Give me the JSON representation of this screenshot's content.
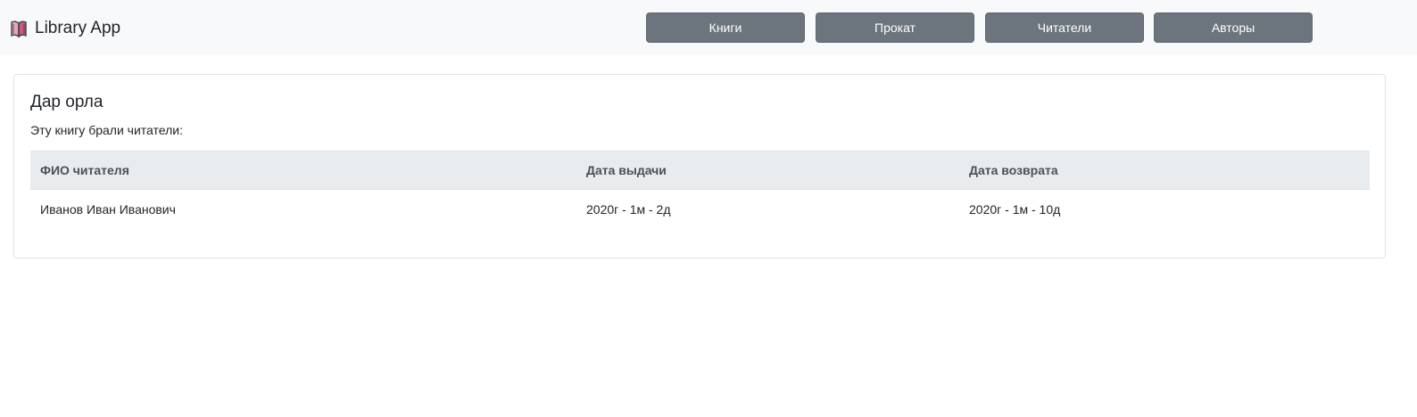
{
  "app": {
    "brand": "Library App",
    "brand_icon": "open-book-icon"
  },
  "nav": {
    "books": "Книги",
    "rentals": "Прокат",
    "readers": "Читатели",
    "authors": "Авторы"
  },
  "book": {
    "title": "Дар орла",
    "subtitle": "Эту книгу брали читатели:"
  },
  "table": {
    "headers": [
      "ФИО читателя",
      "Дата выдачи",
      "Дата возврата"
    ],
    "rows": [
      [
        "Иванов Иван Иванович",
        "2020г - 1м - 2д",
        "2020г - 1м - 10д"
      ]
    ]
  },
  "colors": {
    "navbar_bg": "#f8f9fa",
    "button_bg": "#6c757d",
    "table_header_bg": "#e9ecef"
  }
}
